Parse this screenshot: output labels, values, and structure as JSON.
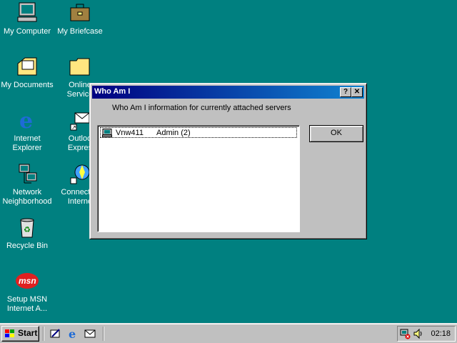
{
  "desktop": {
    "icons": [
      {
        "label": "My Computer"
      },
      {
        "label": "My Briefcase"
      },
      {
        "label": "My Documents"
      },
      {
        "label": "Online\nService"
      },
      {
        "label": "Internet\nExplorer"
      },
      {
        "label": "Outloo\nExpres"
      },
      {
        "label": "Network\nNeighborhood"
      },
      {
        "label": "Connect to\nInterne"
      },
      {
        "label": "Recycle Bin"
      },
      {
        "label": "Setup MSN\nInternet A..."
      }
    ]
  },
  "dialog": {
    "title": "Who Am I",
    "help_label": "?",
    "close_label": "✕",
    "description": "Who Am I information for currently attached servers",
    "servers": [
      {
        "server": "Vnw411",
        "user": "Admin (2)"
      }
    ],
    "ok_label": "OK"
  },
  "taskbar": {
    "start_label": "Start",
    "clock": "02:18"
  },
  "colors": {
    "desktop": "#008080",
    "title_active_start": "#000080",
    "title_active_end": "#1084d0",
    "face": "#c0c0c0"
  }
}
